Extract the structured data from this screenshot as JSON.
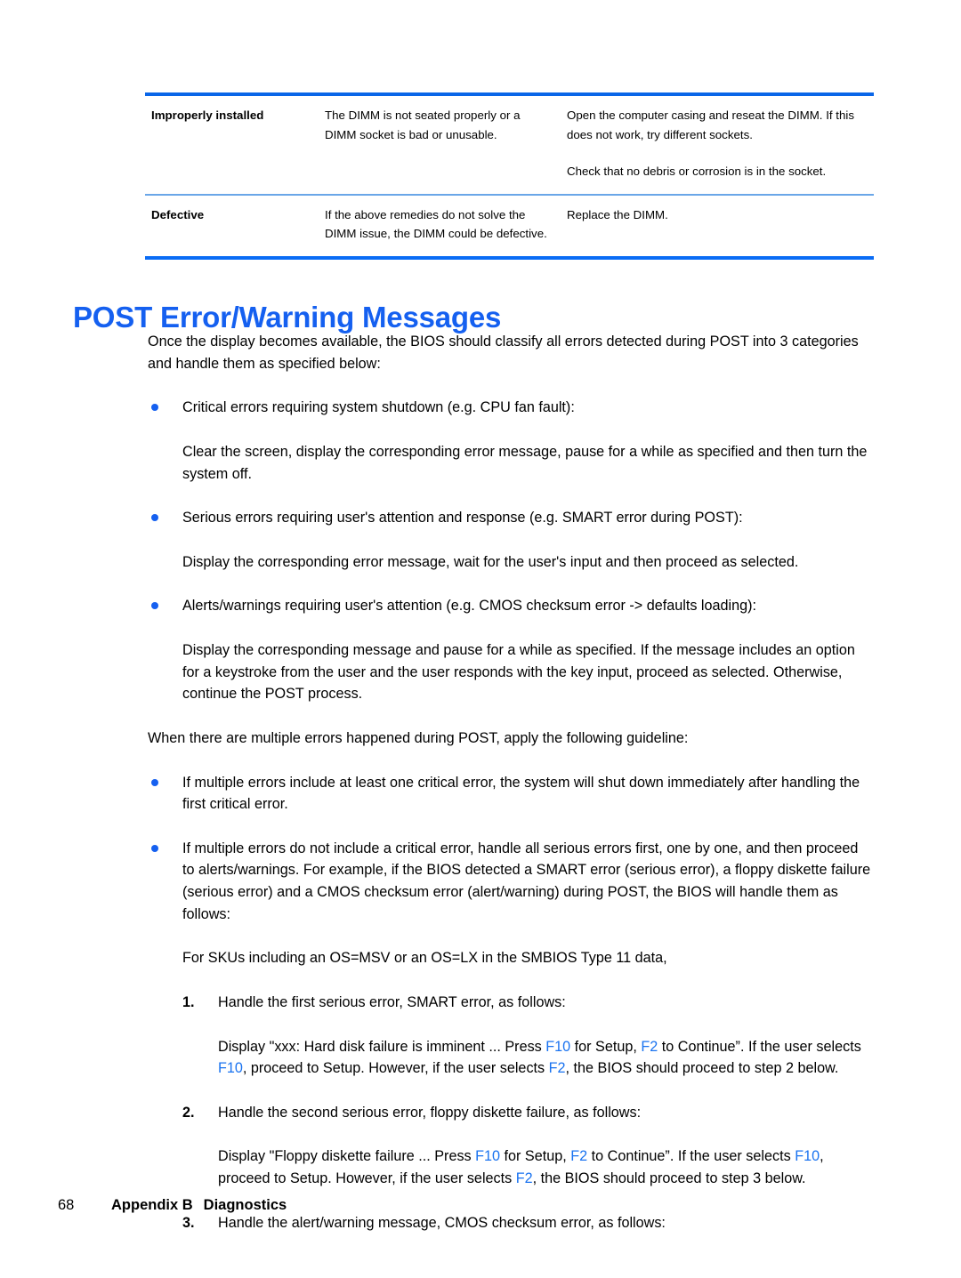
{
  "table": {
    "rows": [
      {
        "cause": "Improperly installed",
        "description": "The DIMM is not seated properly or a DIMM socket is bad or unusable.",
        "remedies": [
          "Open the computer casing and reseat the DIMM. If this does not work, try different sockets.",
          "Check that no debris or corrosion is in the socket."
        ]
      },
      {
        "cause": "Defective",
        "description": "If the above remedies do not solve the DIMM issue, the DIMM could be defective.",
        "remedies": [
          "Replace the DIMM."
        ]
      }
    ]
  },
  "heading": "POST Error/Warning Messages",
  "intro": "Once the display becomes available, the BIOS should classify all errors detected during POST into 3 categories and handle them as specified below:",
  "categories": [
    {
      "bullet": "Critical errors requiring system shutdown (e.g. CPU fan fault):",
      "detail": "Clear the screen, display the corresponding error message, pause for a while as specified and then turn the system off."
    },
    {
      "bullet": "Serious errors requiring user's attention and response (e.g. SMART error during POST):",
      "detail": "Display the corresponding error message, wait for the user's input and then proceed as selected."
    },
    {
      "bullet": "Alerts/warnings requiring user's attention (e.g. CMOS checksum error -> defaults loading):",
      "detail": "Display the corresponding message and pause for a while as specified. If the message includes an option for a keystroke from the user and the user responds with the key input, proceed as selected. Otherwise, continue the POST process."
    }
  ],
  "multi_error_intro": "When there are multiple errors happened during POST, apply the following guideline:",
  "guidelines": [
    "If multiple errors include at least one critical error, the system will shut down immediately after handling the first critical error.",
    "If multiple errors do not include a critical error, handle all serious errors first, one by one, and then proceed to alerts/warnings. For example, if the BIOS detected a SMART error (serious error), a floppy diskette failure (serious error) and a CMOS checksum error (alert/warning) during POST, the BIOS will handle them as follows:"
  ],
  "sku_note": "For SKUs including an OS=MSV or an OS=LX in the SMBIOS Type 11 data,",
  "steps": [
    {
      "number": "1.",
      "title": "Handle the first serious error, SMART error, as follows:",
      "detail_parts": [
        {
          "text": "Display \"xxx: Hard disk failure is imminent ... Press ",
          "style": "normal"
        },
        {
          "text": "F10",
          "style": "key"
        },
        {
          "text": " for Setup, ",
          "style": "normal"
        },
        {
          "text": "F2",
          "style": "key"
        },
        {
          "text": " to Continue”. If the user selects ",
          "style": "normal"
        },
        {
          "text": "F10",
          "style": "key"
        },
        {
          "text": ", proceed to Setup. However, if the user selects ",
          "style": "normal"
        },
        {
          "text": "F2",
          "style": "key"
        },
        {
          "text": ", the BIOS should proceed to step 2 below.",
          "style": "normal"
        }
      ]
    },
    {
      "number": "2.",
      "title": "Handle the second serious error, floppy diskette failure, as follows:",
      "detail_parts": [
        {
          "text": "Display \"Floppy diskette failure ... Press ",
          "style": "normal"
        },
        {
          "text": "F10",
          "style": "key"
        },
        {
          "text": " for Setup, ",
          "style": "normal"
        },
        {
          "text": "F2",
          "style": "key"
        },
        {
          "text": " to Continue”. If the user selects ",
          "style": "normal"
        },
        {
          "text": "F10",
          "style": "key"
        },
        {
          "text": ", proceed to Setup. However, if the user selects ",
          "style": "normal"
        },
        {
          "text": "F2",
          "style": "key"
        },
        {
          "text": ", the BIOS should proceed to step 3 below.",
          "style": "normal"
        }
      ]
    },
    {
      "number": "3.",
      "title": "Handle the alert/warning message, CMOS checksum error, as follows:",
      "detail_parts": []
    }
  ],
  "footer": {
    "page_number": "68",
    "appendix": "Appendix B",
    "chapter": "Diagnostics"
  },
  "colors": {
    "heading_blue": "#1560f0",
    "key_blue": "#1a73f0",
    "table_border_top": "#0a66e8",
    "table_border_bottom": "#0a6cf5",
    "table_row_sep": "#6aa6e8",
    "bullet_blue": "#1560f0"
  }
}
